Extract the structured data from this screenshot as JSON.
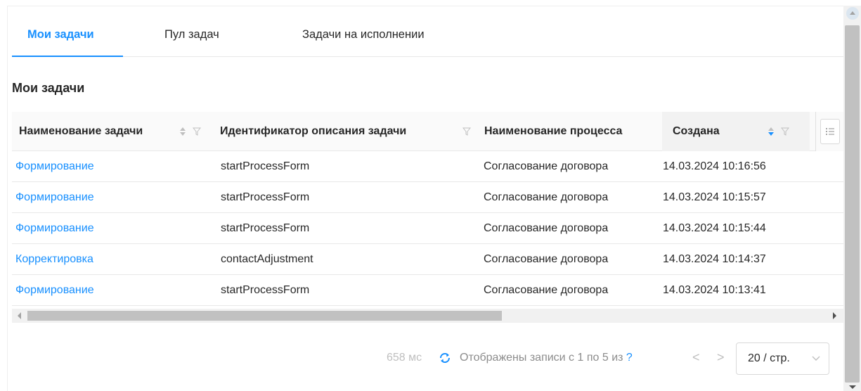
{
  "tabs": [
    {
      "label": "Мои задачи",
      "active": true
    },
    {
      "label": "Пул задач",
      "active": false
    },
    {
      "label": "Задачи на исполнении",
      "active": false
    }
  ],
  "section_title": "Мои задачи",
  "table": {
    "columns": [
      "Наименование задачи",
      "Идентификатор описания задачи",
      "Наименование процесса",
      "Создана"
    ],
    "rows": [
      {
        "task": "Формирование",
        "id": "startProcessForm",
        "process": "Согласование договора",
        "created": "14.03.2024 10:16:56"
      },
      {
        "task": "Формирование",
        "id": "startProcessForm",
        "process": "Согласование договора",
        "created": "14.03.2024 10:15:57"
      },
      {
        "task": "Формирование",
        "id": "startProcessForm",
        "process": "Согласование договора",
        "created": "14.03.2024 10:15:44"
      },
      {
        "task": "Корректировка",
        "id": "contactAdjustment",
        "process": "Согласование договора",
        "created": "14.03.2024 10:14:37"
      },
      {
        "task": "Формирование",
        "id": "startProcessForm",
        "process": "Согласование договора",
        "created": "14.03.2024 10:13:41"
      }
    ]
  },
  "footer": {
    "time": "658 мс",
    "records_text": "Отображены записи с 1 по 5 из",
    "total_unknown": "?",
    "prev": "<",
    "next": ">",
    "page_size": "20 / стр."
  },
  "icons": {
    "sort": "sort-icon",
    "filter": "filter-icon",
    "column_settings": "list-settings-icon",
    "refresh": "refresh-icon",
    "chevron": "chevron-down-icon"
  },
  "colors": {
    "accent": "#1890ff",
    "border": "#e8e8e8",
    "muted": "#bfbfbf"
  }
}
